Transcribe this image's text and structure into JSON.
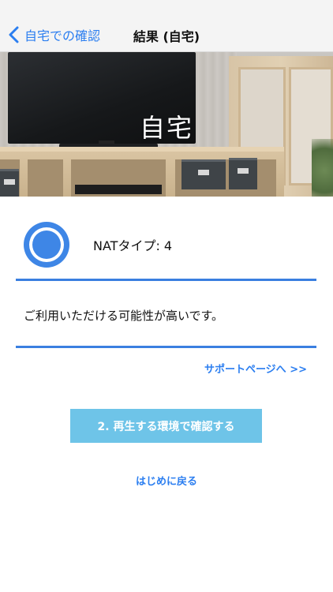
{
  "nav": {
    "back_label": "自宅での確認",
    "title": "結果 (自宅)"
  },
  "hero": {
    "label": "自宅"
  },
  "result": {
    "nat_type_text": "NATタイプ: 4",
    "message": "ご利用いただける可能性が高いです。",
    "support_link": "サポートページへ >>"
  },
  "actions": {
    "primary_button": "2. 再生する環境で確認する",
    "home_link": "はじめに戻る"
  },
  "colors": {
    "accent": "#2b7ef0",
    "status_ring": "#3e86e6",
    "button": "#6ec4e8"
  },
  "icons": {
    "back": "chevron-left-icon",
    "status": "ring-status-icon"
  }
}
